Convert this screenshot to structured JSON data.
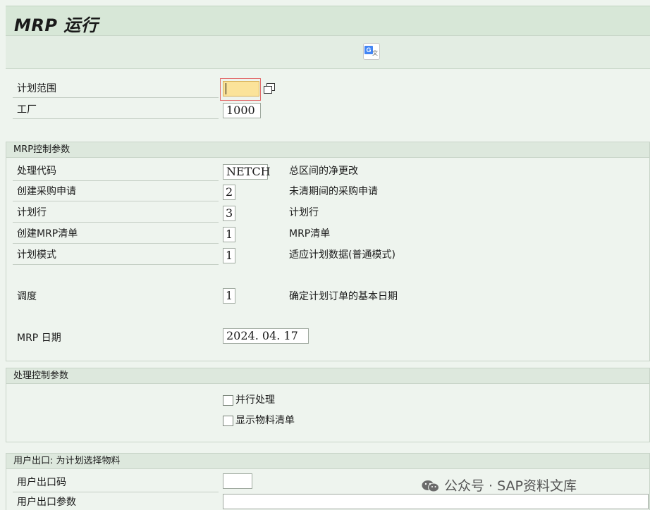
{
  "header": {
    "title": "MRP 运行"
  },
  "toolbar": {
    "translate_icon": "google-translate-icon"
  },
  "main": {
    "planning_scope": {
      "label": "计划范围",
      "value": "",
      "multi_select_icon": "multiple-selection-icon"
    },
    "plant": {
      "label": "工厂",
      "value": "1000"
    }
  },
  "mrp_control": {
    "title": "MRP控制参数",
    "rows": [
      {
        "label": "处理代码",
        "value": "NETCH",
        "desc": "总区间的净更改"
      },
      {
        "label": "创建采购申请",
        "value": "2",
        "desc": "未清期间的采购申请"
      },
      {
        "label": "计划行",
        "value": "3",
        "desc": "计划行"
      },
      {
        "label": "创建MRP清单",
        "value": "1",
        "desc": "MRP清单"
      },
      {
        "label": "计划模式",
        "value": "1",
        "desc": "适应计划数据(普通模式)"
      },
      {
        "label": "调度",
        "value": "1",
        "desc": "确定计划订单的基本日期"
      }
    ],
    "date": {
      "label": "MRP 日期",
      "value": "2024. 04. 17"
    }
  },
  "process_control": {
    "title": "处理控制参数",
    "parallel": {
      "label": "并行处理",
      "checked": false
    },
    "display_material_list": {
      "label": "显示物料清单",
      "checked": false
    }
  },
  "user_exit": {
    "title": "用户出口: 为计划选择物料",
    "code": {
      "label": "用户出口码",
      "value": ""
    },
    "param": {
      "label": "用户出口参数",
      "value": ""
    }
  },
  "watermark": {
    "text": "公众号 · SAP资料文库",
    "icon": "wechat-icon"
  }
}
